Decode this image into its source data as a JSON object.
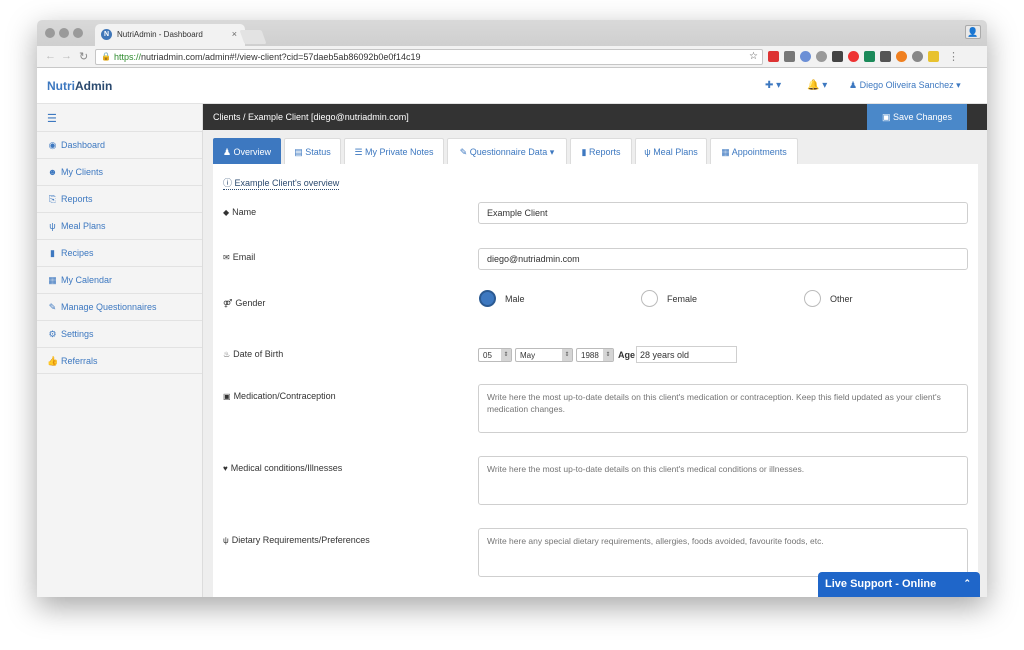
{
  "browser": {
    "tab_title": "NutriAdmin - Dashboard",
    "tab_close": "×",
    "favicon_letter": "N",
    "url_https": "https://",
    "url_rest": "nutriadmin.com/admin#!/view-client?cid=57daeb5ab86092b0e0f14c19"
  },
  "header": {
    "brand_prefix": "Nutri",
    "brand_suffix": "Admin",
    "user_name": "Diego Oliveira Sanchez"
  },
  "sidebar": {
    "items": [
      {
        "label": "Dashboard",
        "icon": "dashboard-icon"
      },
      {
        "label": "My Clients",
        "icon": "users-icon"
      },
      {
        "label": "Reports",
        "icon": "reports-icon"
      },
      {
        "label": "Meal Plans",
        "icon": "cutlery-icon"
      },
      {
        "label": "Recipes",
        "icon": "book-icon"
      },
      {
        "label": "My Calendar",
        "icon": "calendar-icon"
      },
      {
        "label": "Manage Questionnaires",
        "icon": "edit-icon"
      },
      {
        "label": "Settings",
        "icon": "gear-icon"
      },
      {
        "label": "Referrals",
        "icon": "thumbs-up-icon"
      }
    ]
  },
  "topbar": {
    "breadcrumb": "Clients  /  Example Client [diego@nutriadmin.com]",
    "save_label": "Save Changes"
  },
  "tabs": [
    {
      "label": "Overview",
      "active": true
    },
    {
      "label": "Status"
    },
    {
      "label": "My Private Notes"
    },
    {
      "label": "Questionnaire Data ▾"
    },
    {
      "label": "Reports"
    },
    {
      "label": "Meal Plans"
    },
    {
      "label": "Appointments"
    }
  ],
  "form": {
    "overview_link": "Example Client's overview",
    "name_label": "Name",
    "name_value": "Example Client",
    "email_label": "Email",
    "email_value": "diego@nutriadmin.com",
    "gender_label": "Gender",
    "gender_options": [
      "Male",
      "Female",
      "Other"
    ],
    "gender_selected": "Male",
    "dob_label": "Date of Birth",
    "dob_day": "05",
    "dob_month": "May",
    "dob_year": "1988",
    "age_label": "Age",
    "age_value": "28 years old",
    "medication_label": "Medication/Contraception",
    "medication_placeholder": "Write here the most up-to-date details on this client's medication or contraception. Keep this field updated as your client's medication changes.",
    "conditions_label": "Medical conditions/Illnesses",
    "conditions_placeholder": "Write here the most up-to-date details on this client's medical conditions or illnesses.",
    "dietary_label": "Dietary Requirements/Preferences",
    "dietary_placeholder": "Write here any special dietary requirements, allergies, foods avoided, favourite foods, etc."
  },
  "live_support": {
    "label": "Live Support - Online"
  },
  "colors": {
    "accent": "#3d78c0",
    "topbar": "#333333",
    "live_support": "#1f66c9"
  }
}
